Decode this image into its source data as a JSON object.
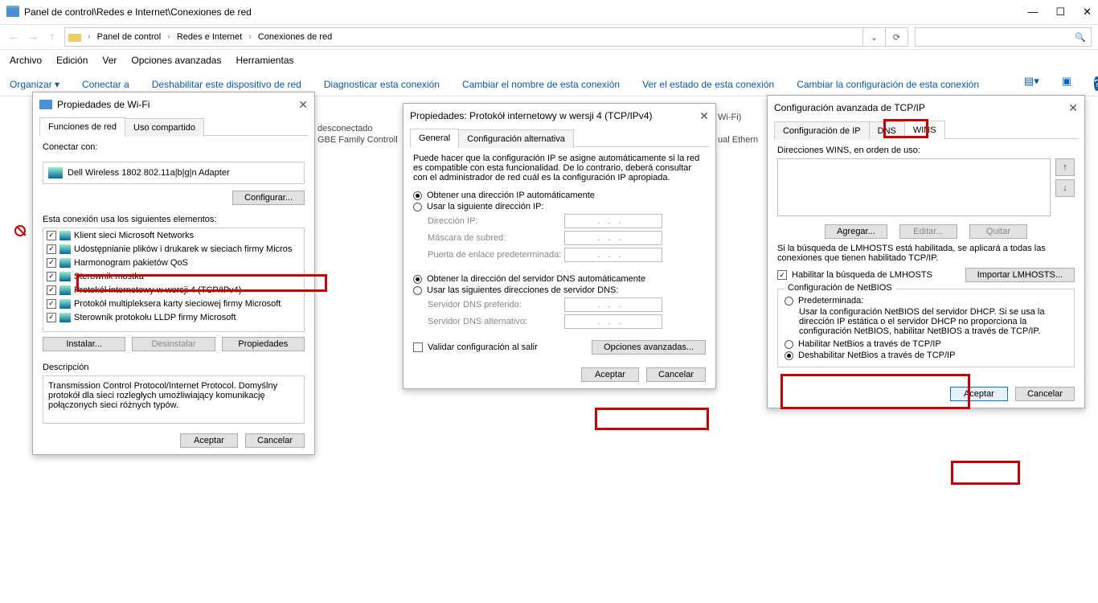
{
  "window": {
    "title": "Panel de control\\Redes e Internet\\Conexiones de red",
    "min": "—",
    "max": "☐",
    "close": "✕",
    "breadcrumbs": [
      "Panel de control",
      "Redes e Internet",
      "Conexiones de red"
    ]
  },
  "menubar": [
    "Archivo",
    "Edición",
    "Ver",
    "Opciones avanzadas",
    "Herramientas"
  ],
  "cmdbar": {
    "organize": "Organizar",
    "connect": "Conectar a",
    "disable": "Deshabilitar este dispositivo de red",
    "diagnose": "Diagnosticar esta conexión",
    "rename": "Cambiar el nombre de esta conexión",
    "status": "Ver el estado de esta conexión",
    "change": "Cambiar la configuración de esta conexión"
  },
  "bg": {
    "disconnected": "desconectado",
    "gbe": "GBE Family Controll",
    "wifi": "Wi-Fi)",
    "ether": "ual Ethern"
  },
  "dlg1": {
    "title": "Propiedades de Wi-Fi",
    "tab_net": "Funciones de red",
    "tab_share": "Uso compartido",
    "connect_with": "Conectar con:",
    "adapter": "Dell Wireless 1802 802.11a|b|g|n Adapter",
    "configure": "Configurar...",
    "uses_following": "Esta conexión usa los siguientes elementos:",
    "items": [
      "Klient sieci Microsoft Networks",
      "Udostępnianie plików i drukarek w sieciach firmy Micros",
      "Harmonogram pakietów QoS",
      "Sterownik mostka",
      "Protokół internetowy w wersji 4 (TCP/IPv4)",
      "Protokół multipleksera karty sieciowej firmy Microsoft",
      "Sterownik protokołu LLDP firmy Microsoft"
    ],
    "install": "Instalar...",
    "uninstall": "Desinstalar",
    "properties": "Propiedades",
    "desc_label": "Descripción",
    "desc": "Transmission Control Protocol/Internet Protocol. Domyślny protokół dla sieci rozległych umożliwiający komunikację połączonych sieci różnych typów.",
    "ok": "Aceptar",
    "cancel": "Cancelar"
  },
  "dlg2": {
    "title": "Propiedades: Protokół internetowy w wersji 4 (TCP/IPv4)",
    "tab_gen": "General",
    "tab_alt": "Configuración alternativa",
    "intro": "Puede hacer que la configuración IP se asigne automáticamente si la red es compatible con esta funcionalidad. De lo contrario, deberá consultar con el administrador de red cuál es la configuración IP apropiada.",
    "r_auto_ip": "Obtener una dirección IP automáticamente",
    "r_use_ip": "Usar la siguiente dirección IP:",
    "ip": "Dirección IP:",
    "mask": "Máscara de subred:",
    "gw": "Puerta de enlace predeterminada:",
    "r_auto_dns": "Obtener la dirección del servidor DNS automáticamente",
    "r_use_dns": "Usar las siguientes direcciones de servidor DNS:",
    "dns1": "Servidor DNS preferido:",
    "dns2": "Servidor DNS alternativo:",
    "validate": "Validar configuración al salir",
    "advanced": "Opciones avanzadas...",
    "ok": "Aceptar",
    "cancel": "Cancelar"
  },
  "dlg3": {
    "title": "Configuración avanzada de TCP/IP",
    "tab_ip": "Configuración de IP",
    "tab_dns": "DNS",
    "tab_wins": "WINS",
    "wins_order": "Direcciones WINS, en orden de uso:",
    "add": "Agregar...",
    "edit": "Editar...",
    "remove": "Quitar",
    "lmhosts_note": "Si la búsqueda de LMHOSTS está habilitada, se aplicará a todas las conexiones que tienen habilitado TCP/IP.",
    "enable_lm": "Habilitar la búsqueda de LMHOSTS",
    "import_lm": "Importar LMHOSTS...",
    "netbios_legend": "Configuración de NetBIOS",
    "r_default": "Predeterminada:",
    "default_desc": "Usar la configuración NetBIOS del servidor DHCP. Si se usa la dirección IP estática o el servidor DHCP no proporciona la configuración NetBIOS, habilitar NetBIOS a través de TCP/IP.",
    "r_enable": "Habilitar NetBios a través de TCP/IP",
    "r_disable": "Deshabilitar NetBios a través de TCP/IP",
    "ok": "Aceptar",
    "cancel": "Cancelar"
  }
}
